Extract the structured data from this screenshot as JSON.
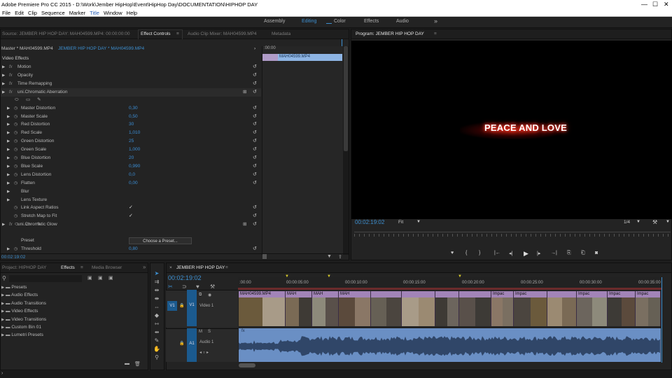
{
  "app": {
    "title": "Adobe Premiere Pro CC 2015 - D:\\Work\\Jember HipHop\\Event\\HipHop Day\\DOCUMENTATION\\HIPHOP DAY"
  },
  "menu": [
    "File",
    "Edit",
    "Clip",
    "Sequence",
    "Marker",
    "Title",
    "Window",
    "Help"
  ],
  "workspaces": {
    "items": [
      "Assembly",
      "Editing",
      "Color",
      "Effects",
      "Audio"
    ],
    "active": "Editing",
    "more": "»"
  },
  "source_panel": {
    "tabs": [
      "Source: JEMBER HIP HOP DAY: MAH04599.MP4: 00:00:00:00",
      "Effect Controls",
      "Audio Clip Mixer: MAH04599.MP4",
      "Metadata"
    ],
    "active_tab": "Effect Controls",
    "master_label": "Master * MAH04599.MP4",
    "sequence_label": "JEMBER HIP HOP DAY * MAH04599.MP4",
    "section": "Video Effects",
    "timecode": "00:02:19:02",
    "mini_timeline": {
      "start": ":00:00",
      "clip": "MAH04599.MP4"
    },
    "rows": [
      {
        "type": "effect",
        "label": "Motion"
      },
      {
        "type": "effect",
        "label": "Opacity"
      },
      {
        "type": "effect",
        "label": "Time Remapping"
      },
      {
        "type": "effect",
        "label": "uni.Chromatic Aberration"
      },
      {
        "type": "param",
        "label": "Master Distortion",
        "value": "0,30"
      },
      {
        "type": "param",
        "label": "Master Scale",
        "value": "0,50"
      },
      {
        "type": "param",
        "label": "Red Distortion",
        "value": "30"
      },
      {
        "type": "param",
        "label": "Red Scale",
        "value": "1,010"
      },
      {
        "type": "param",
        "label": "Green Distortion",
        "value": "25"
      },
      {
        "type": "param",
        "label": "Green Scale",
        "value": "1,000"
      },
      {
        "type": "param",
        "label": "Blue Distortion",
        "value": "20"
      },
      {
        "type": "param",
        "label": "Blue Scale",
        "value": "0,990"
      },
      {
        "type": "param",
        "label": "Lens Distortion",
        "value": "0,0"
      },
      {
        "type": "param",
        "label": "Flatten",
        "value": "0,00"
      },
      {
        "type": "group",
        "label": "Blur"
      },
      {
        "type": "group",
        "label": "Lens Texture"
      },
      {
        "type": "check",
        "label": "Link Aspect Ratios",
        "value": "✓"
      },
      {
        "type": "check",
        "label": "Stretch Map to Fit",
        "value": "✓"
      },
      {
        "type": "effect",
        "label": "uni.Chromatic Glow"
      },
      {
        "type": "preset",
        "label": "Preset",
        "value": "Choose a Preset..."
      },
      {
        "type": "param",
        "label": "Threshold",
        "value": "0,80"
      }
    ]
  },
  "program": {
    "tab": "Program: JEMBER HIP HOP DAY",
    "overlay_text": "PEACE AND LOVE",
    "timecode": "00:02:19:02",
    "fit": "Fit",
    "resolution": "1/4"
  },
  "project": {
    "tabs": [
      "Project: HIPHOP DAY",
      "Effects",
      "Media Browser"
    ],
    "active_tab": "Effects",
    "bins": [
      "Presets",
      "Audio Effects",
      "Audio Transitions",
      "Video Effects",
      "Video Transitions",
      "Custom Bin 01",
      "Lumetri Presets"
    ]
  },
  "timeline": {
    "tab": "JEMBER HIP HOP DAY",
    "timecode": "00:02:19:02",
    "ruler": [
      ":00:00",
      "00:00:05:00",
      "00:00:10:00",
      "00:00:15:00",
      "00:00:20:00",
      "00:00:25:00",
      "00:00:30:00",
      "00:00:35:00"
    ],
    "video_track": {
      "tag": "V1",
      "name": "Video 1"
    },
    "audio_track": {
      "tag": "A1",
      "name": "Audio 1"
    },
    "clips": [
      "MAH04599.MP4",
      "MAH",
      "MAH",
      "MAH",
      "Impac",
      "Impac",
      "Impac",
      "Impac",
      "Impac"
    ]
  },
  "colors": {
    "accent": "#3d8fd0",
    "clip_video": "#a284b8",
    "clip_audio": "#6a8fc4",
    "overlay_red": "#ff3a2a"
  }
}
